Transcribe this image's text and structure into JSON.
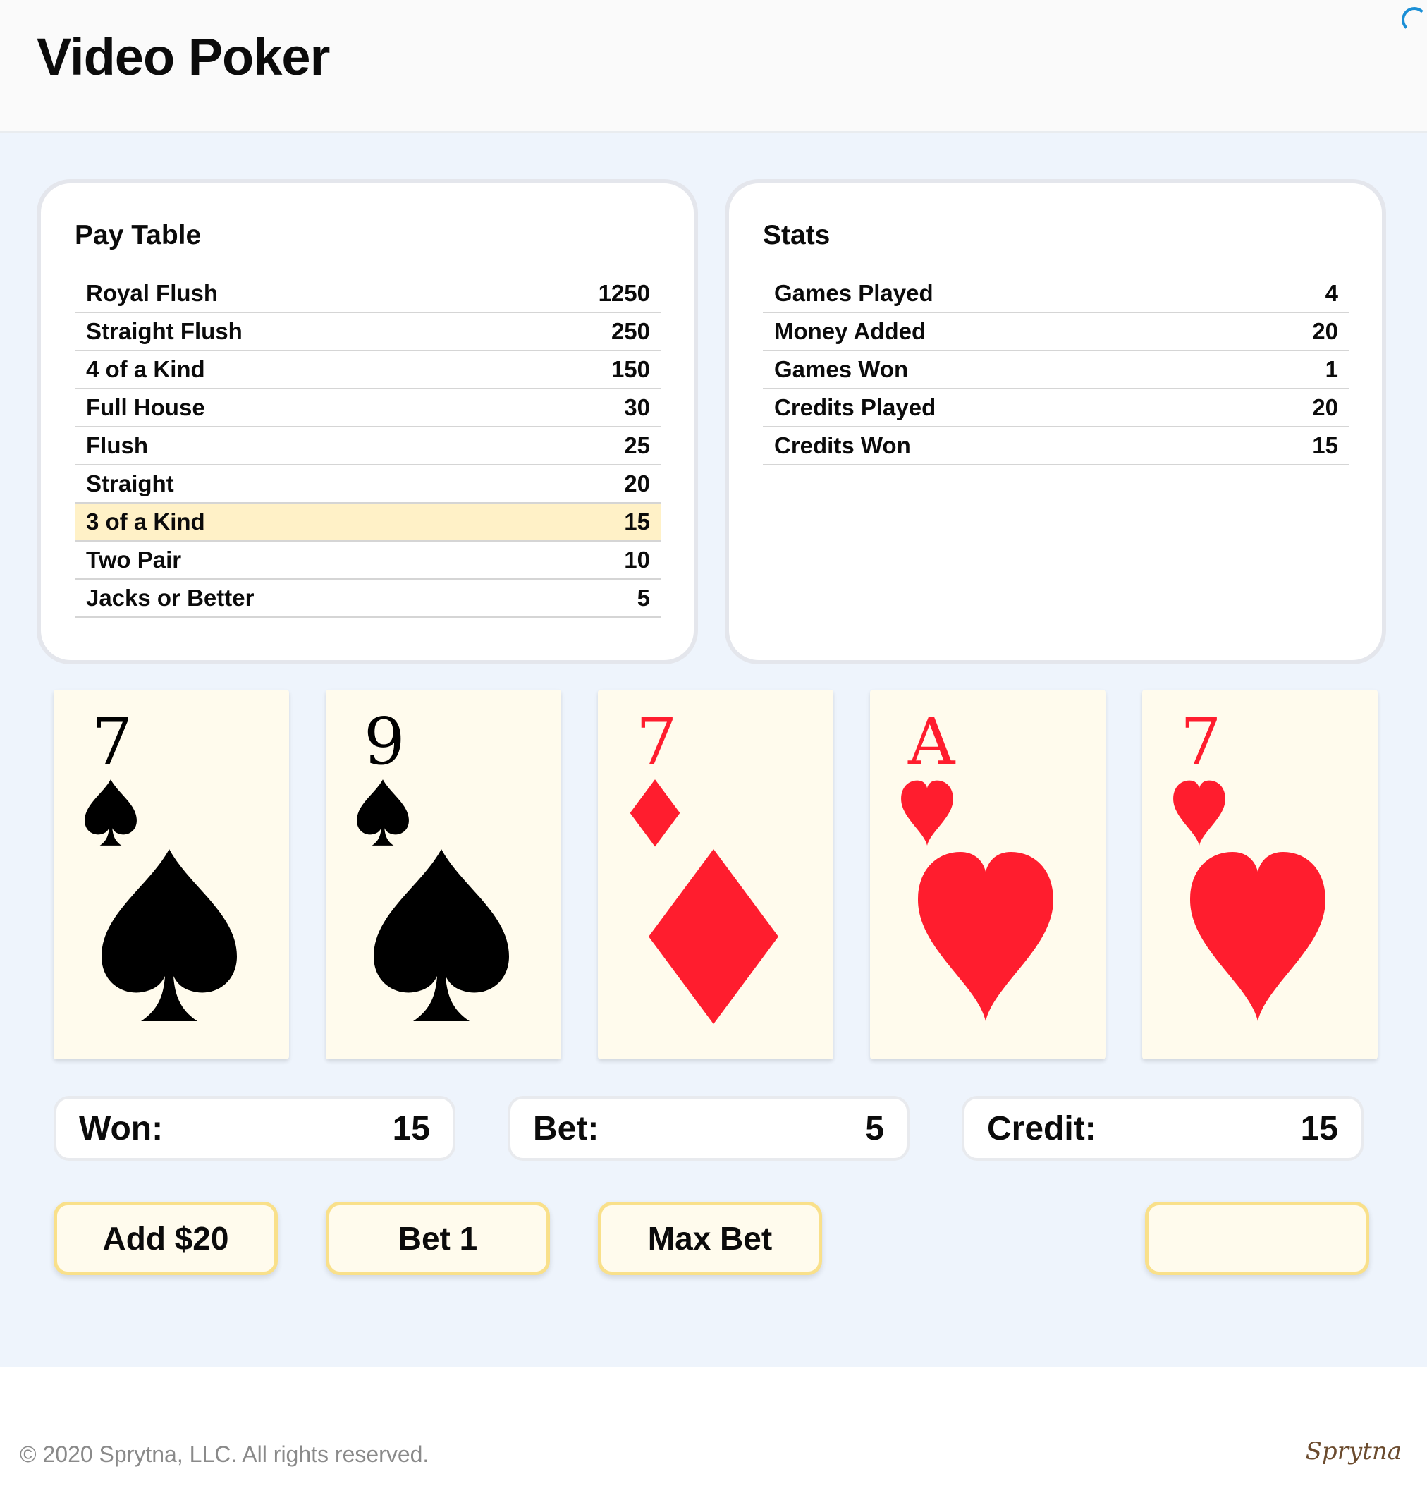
{
  "header": {
    "title": "Video Poker"
  },
  "pay_table": {
    "title": "Pay Table",
    "rows": [
      {
        "hand": "Royal Flush",
        "payout": "1250"
      },
      {
        "hand": "Straight Flush",
        "payout": "250"
      },
      {
        "hand": "4 of a Kind",
        "payout": "150"
      },
      {
        "hand": "Full House",
        "payout": "30"
      },
      {
        "hand": "Flush",
        "payout": "25"
      },
      {
        "hand": "Straight",
        "payout": "20"
      },
      {
        "hand": "3 of a Kind",
        "payout": "15"
      },
      {
        "hand": "Two Pair",
        "payout": "10"
      },
      {
        "hand": "Jacks or Better",
        "payout": "5"
      }
    ],
    "highlighted_hand": "3 of a Kind",
    "highlight_color": "#fff1c7"
  },
  "stats": {
    "title": "Stats",
    "rows": [
      {
        "label": "Games Played",
        "value": "4"
      },
      {
        "label": "Money Added",
        "value": "20"
      },
      {
        "label": "Games Won",
        "value": "1"
      },
      {
        "label": "Credits Played",
        "value": "20"
      },
      {
        "label": "Credits Won",
        "value": "15"
      }
    ]
  },
  "cards": [
    {
      "rank": "7",
      "suit": "spade",
      "color": "black"
    },
    {
      "rank": "9",
      "suit": "spade",
      "color": "black"
    },
    {
      "rank": "7",
      "suit": "diamond",
      "color": "red"
    },
    {
      "rank": "A",
      "suit": "heart",
      "color": "red"
    },
    {
      "rank": "7",
      "suit": "heart",
      "color": "red"
    }
  ],
  "info": {
    "won_label": "Won:",
    "won_value": "15",
    "bet_label": "Bet:",
    "bet_value": "5",
    "credit_label": "Credit:",
    "credit_value": "15"
  },
  "buttons": {
    "add": "Add $20",
    "bet_one": "Bet 1",
    "max_bet": "Max Bet",
    "deal": ""
  },
  "footer": {
    "copyright": "© 2020 Sprytna, LLC. All rights reserved.",
    "brand": "Sprytna"
  },
  "colors": {
    "red_suit": "#ff1d2e",
    "black_suit": "#000000",
    "button_border": "#f9e08a",
    "background": "#eef4fc",
    "card_face": "#fffbed"
  }
}
